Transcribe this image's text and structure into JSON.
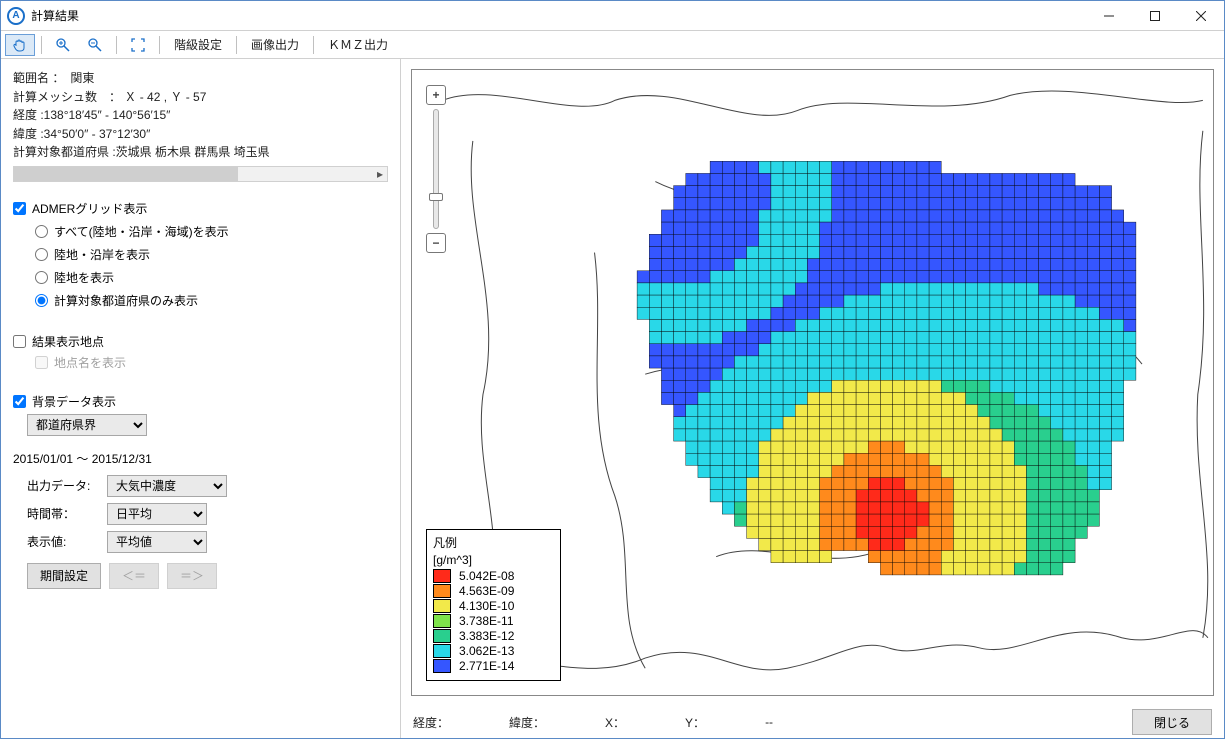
{
  "window": {
    "title": "計算結果"
  },
  "toolbar": {
    "hand_icon": "hand-icon",
    "zoom_in_icon": "zoom-in-icon",
    "zoom_out_icon": "zoom-out-icon",
    "fit_icon": "fit-extents-icon",
    "class_settings": "階級設定",
    "image_export": "画像出力",
    "kmz_export": "ＫＭＺ出力"
  },
  "info": {
    "range_name_label": "範囲名 ：",
    "range_name": "関東",
    "mesh_label": "計算メッシュ数　：",
    "mesh_value": "Ｘ - 42 , Ｙ - 57",
    "lon_label": "経度  :",
    "lon_value": "138°18′45″ - 140°56′15″",
    "lat_label": "緯度  :",
    "lat_value": "34°50′0″ - 37°12′30″",
    "pref_label": "計算対象都道府県 :",
    "pref_value": "茨城県 栃木県 群馬県 埼玉県"
  },
  "grid": {
    "checkbox_label": "ADMERグリッド表示",
    "options": [
      "すべて(陸地・沿岸・海域)を表示",
      "陸地・沿岸を表示",
      "陸地を表示",
      "計算対象都道府県のみ表示"
    ],
    "selected_index": 3
  },
  "points": {
    "checkbox_label": "結果表示地点",
    "sub_label": "地点名を表示"
  },
  "background": {
    "checkbox_label": "背景データ表示",
    "dropdown_value": "都道府県界"
  },
  "period": {
    "range_text": "2015/01/01 ～ 2015/12/31",
    "output_label": "出力データ:",
    "output_value": "大気中濃度",
    "time_label": "時間帯：",
    "time_value": "日平均",
    "disp_label": "表示値:",
    "disp_value": "平均値",
    "period_btn": "期間設定",
    "prev_btn": "＜＝",
    "next_btn": "＝＞"
  },
  "legend": {
    "title1": "凡例",
    "title2": "[g/m^3]",
    "items": [
      {
        "color": "#ff2a1a",
        "label": "5.042E-08"
      },
      {
        "color": "#ff8a1c",
        "label": "4.563E-09"
      },
      {
        "color": "#f2e94a",
        "label": "4.130E-10"
      },
      {
        "color": "#7ee34a",
        "label": "3.738E-11"
      },
      {
        "color": "#29cf8e",
        "label": "3.383E-12"
      },
      {
        "color": "#29d8e8",
        "label": "3.062E-13"
      },
      {
        "color": "#3556ff",
        "label": "2.771E-14"
      }
    ]
  },
  "status": {
    "lon": "経度：",
    "lat": "緯度：",
    "x": "X：",
    "y": "Y：",
    "dash": "--",
    "close": "閉じる"
  },
  "zoom": {
    "plus": "+",
    "minus": "−"
  }
}
